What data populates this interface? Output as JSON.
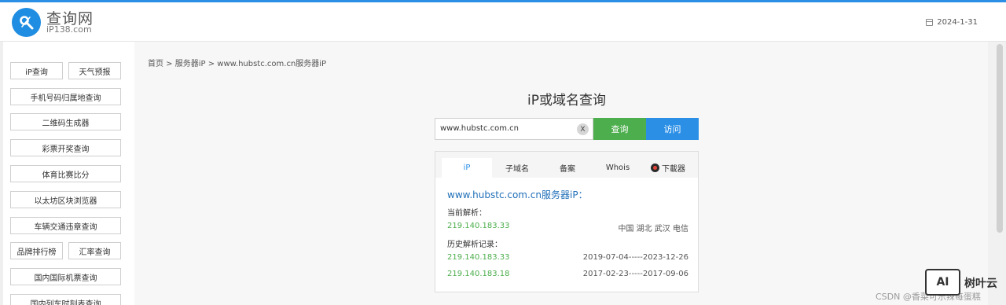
{
  "header": {
    "logo_title": "查询网",
    "logo_sub": "iP138.com",
    "date": "2024-1-31"
  },
  "sidebar": {
    "items": [
      "iP查询",
      "天气预报",
      "手机号码归属地查询",
      "二维码生成器",
      "彩票开奖查询",
      "体育比赛比分",
      "以太坊区块浏览器",
      "车辆交通违章查询",
      "品牌排行榜",
      "汇率查询",
      "国内国际机票查询",
      "国内列车时刻表查询"
    ]
  },
  "breadcrumb": "首页 > 服务器iP > www.hubstc.com.cn服务器iP",
  "search": {
    "title": "iP或域名查询",
    "value": "www.hubstc.com.cn",
    "clear": "X",
    "query_label": "查询",
    "visit_label": "访问"
  },
  "tabs": [
    "iP",
    "子域名",
    "备案",
    "Whois",
    "下載器"
  ],
  "result": {
    "title": "www.hubstc.com.cn服务器iP：",
    "current_label": "当前解析：",
    "current_ip": "219.140.183.33",
    "current_location": "中国 湖北 武汉 电信",
    "history_label": "历史解析记录：",
    "history": [
      {
        "ip": "219.140.183.33",
        "range": "2019-07-04-----2023-12-26"
      },
      {
        "ip": "219.140.183.18",
        "range": "2017-02-23-----2017-09-06"
      }
    ]
  },
  "watermark": {
    "csdn": "CSDN @香菜可乐辣每蛋糕",
    "badge": "AI",
    "brand": "树叶云"
  },
  "colors": {
    "accent": "#2b8fe6",
    "green": "#4cae4c"
  }
}
